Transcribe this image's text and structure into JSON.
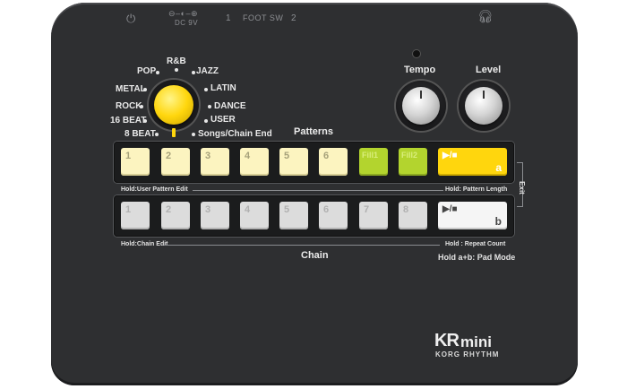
{
  "top_jacks": {
    "dc_label": "DC 9V",
    "sw1": "1",
    "footsw": "FOOT SW",
    "sw2": "2"
  },
  "genres_left": [
    "POP",
    "METAL",
    "ROCK",
    "16 BEAT",
    "8 BEAT"
  ],
  "genre_top": "R&B",
  "genres_right": [
    "JAZZ",
    "LATIN",
    "DANCE",
    "USER",
    "Songs/Chain End"
  ],
  "patterns_label": "Patterns",
  "tempo_label": "Tempo",
  "level_label": "Level",
  "pattern_pads": [
    "1",
    "2",
    "3",
    "4",
    "5",
    "6",
    "Fill1",
    "Fill2"
  ],
  "pattern_play": {
    "icon": "▶/■",
    "letter": "a"
  },
  "chain_pads": [
    "1",
    "2",
    "3",
    "4",
    "5",
    "6",
    "7",
    "8"
  ],
  "chain_play": {
    "icon": "▶/■",
    "letter": "b"
  },
  "hold_user_pattern_edit": "Hold:User Pattern Edit",
  "hold_pattern_length": "Hold: Pattern Length",
  "exit_label": "Exit",
  "hold_chain_edit": "Hold:Chain Edit",
  "chain_label": "Chain",
  "hold_repeat_count": "Hold : Repeat Count",
  "hold_pad_mode": "Hold a+b: Pad Mode",
  "brand": {
    "kr": "KR",
    "mini": "mini",
    "sub": "KORG RHYTHM"
  },
  "colors": {
    "body": "#2e2f31",
    "knob_yellow": "#ffd60d",
    "pad_yellow": "#fcf4c0",
    "pad_green": "#b3d42e",
    "pad_white": "#dcdcdc"
  }
}
